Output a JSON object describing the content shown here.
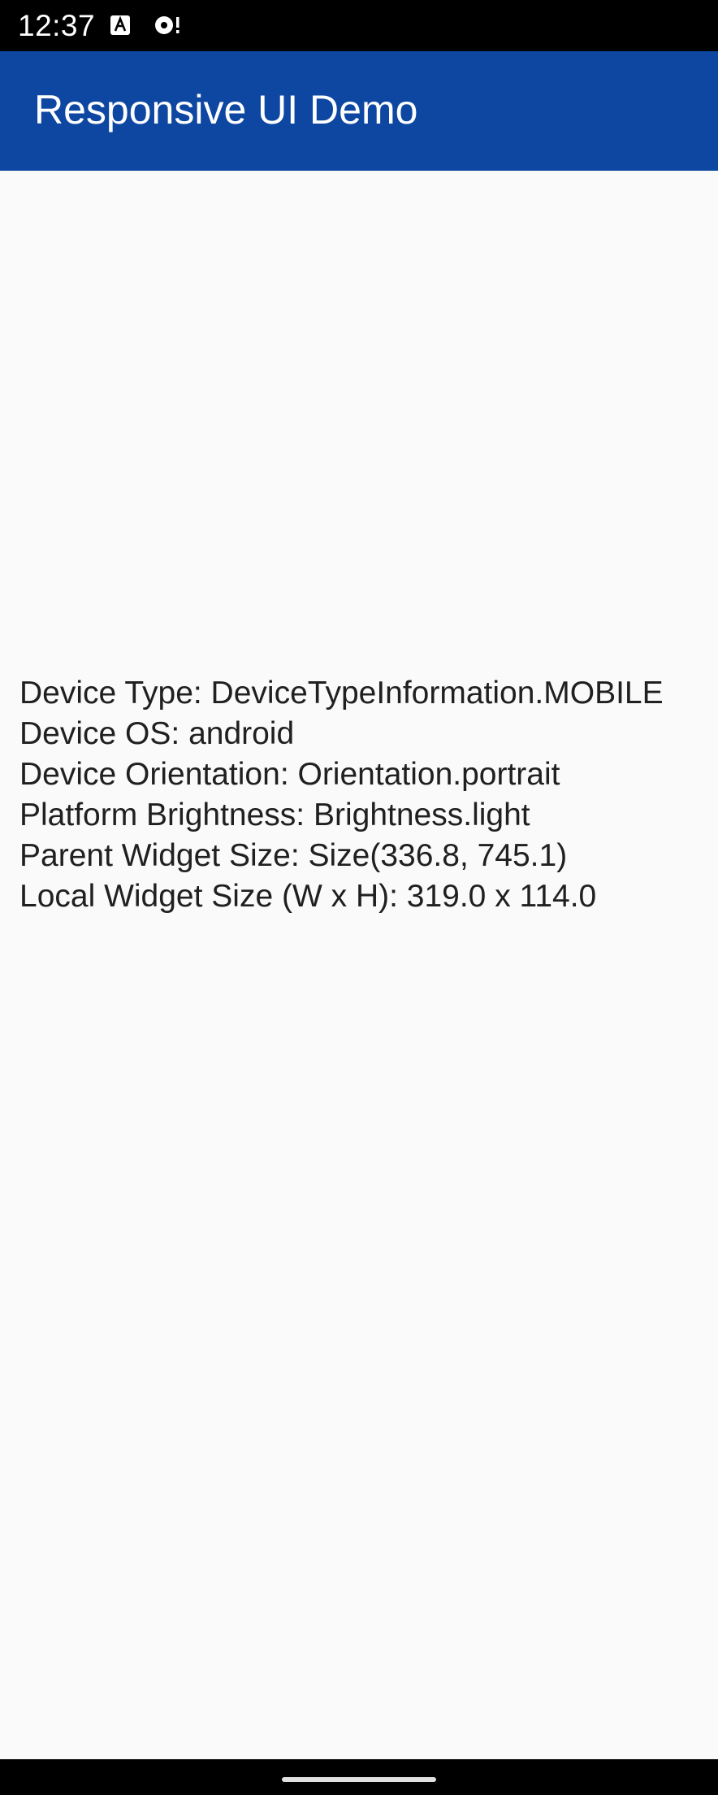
{
  "status_bar": {
    "time": "12:37",
    "icons": [
      "accessibility-a-icon",
      "sync-alert-icon"
    ]
  },
  "app_bar": {
    "title": "Responsive UI Demo",
    "color": "#0d47a1"
  },
  "info": {
    "lines": [
      "Device Type: DeviceTypeInformation.MOBILE",
      "Device OS: android",
      "Device Orientation: Orientation.portrait",
      "Platform Brightness: Brightness.light",
      "Parent Widget Size: Size(336.8, 745.1)",
      "Local Widget Size (W x H): 319.0 x 114.0"
    ]
  },
  "nav_bar": {
    "icons": [
      "home-handle-icon"
    ]
  }
}
